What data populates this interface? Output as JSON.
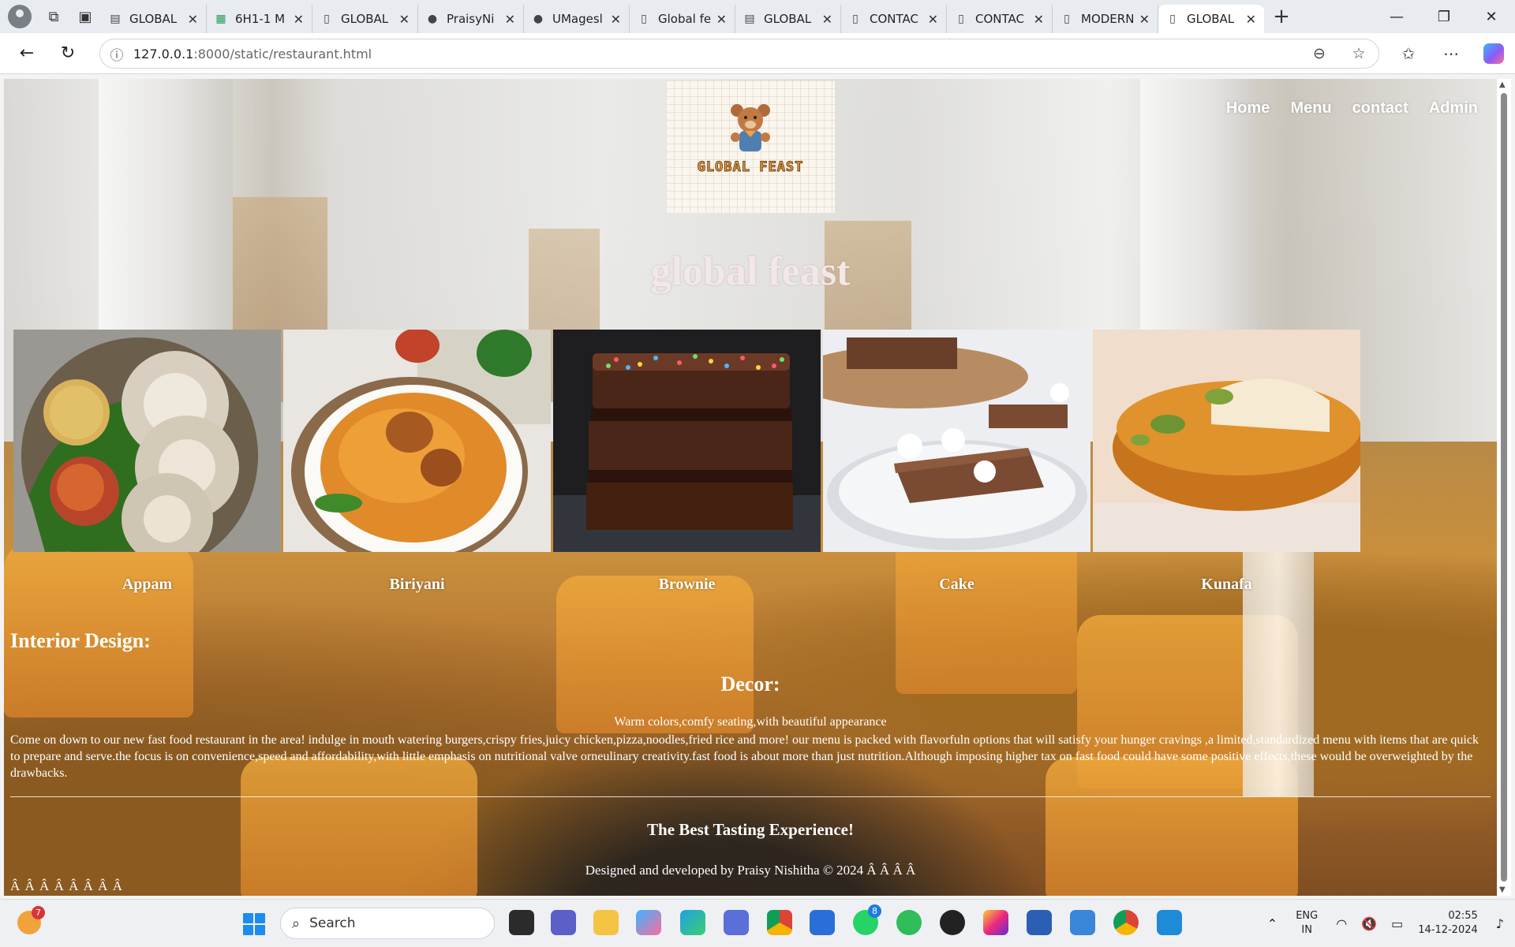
{
  "browser": {
    "tabs": [
      {
        "title": "GLOBAL",
        "icon": "page-icon"
      },
      {
        "title": "6H1-1 M",
        "icon": "sheets-icon"
      },
      {
        "title": "GLOBAL",
        "icon": "page-icon"
      },
      {
        "title": "PraisyNi",
        "icon": "github-icon"
      },
      {
        "title": "UMagesl",
        "icon": "github-icon"
      },
      {
        "title": "Global fe",
        "icon": "page-icon"
      },
      {
        "title": "GLOBAL",
        "icon": "page-icon"
      },
      {
        "title": "CONTAC",
        "icon": "page-icon"
      },
      {
        "title": "CONTAC",
        "icon": "page-icon"
      },
      {
        "title": "MODERN",
        "icon": "page-icon"
      },
      {
        "title": "GLOBAL",
        "icon": "page-icon",
        "active": true
      }
    ],
    "url_host": "127.0.0.1",
    "url_rest": ":8000/static/restaurant.html"
  },
  "site": {
    "nav": [
      "Home",
      "Menu",
      "contact",
      "Admin"
    ],
    "logo_text": "GLOBAL FEAST",
    "title": "global feast",
    "dishes": [
      {
        "name": "Appam"
      },
      {
        "name": "Biriyani"
      },
      {
        "name": "Brownie"
      },
      {
        "name": "Cake"
      },
      {
        "name": "Kunafa"
      }
    ],
    "interior_heading": "Interior Design:",
    "decor_heading": "Decor:",
    "decor_text": "Warm colors,comfy seating,with beautiful appearance",
    "paragraph": "Come on down to our new fast food restaurant in the area! indulge in mouth watering burgers,crispy fries,juicy chicken,pizza,noodles,fried rice and more! our menu is packed with flavorfuln options that will satisfy your hunger cravings ,a limited,standardized menu with items that are quick to prepare and serve.the focus is on convenience,speed and affordability,with little emphasis on nutritional valve orneulinary creativity.fast food is about more than just nutrition.Although imposing higher tax on fast food could have some positive effects,these would be overweighted by the drawbacks.",
    "tagline": "The Best Tasting Experience!",
    "credit": "Designed and developed by Praisy Nishitha © 2024 Â Â Â Â",
    "artifacts": "Â Â Â Â Â Â Â Â"
  },
  "taskbar": {
    "weather_badge": "7",
    "search_placeholder": "Search",
    "whatsapp_badge": "8",
    "lang_line1": "ENG",
    "lang_line2": "IN",
    "time": "02:55",
    "date": "14-12-2024"
  },
  "colors": {
    "nav_text": "#ffffff",
    "title_text": "#f3e7e7",
    "logo_text": "#f0a642"
  }
}
